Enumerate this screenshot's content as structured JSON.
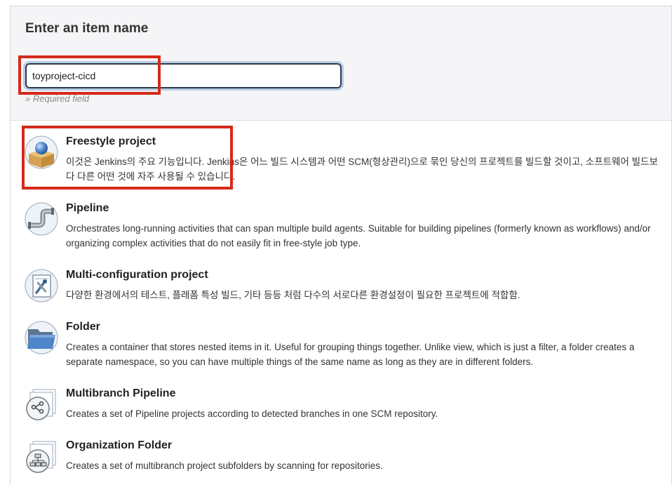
{
  "form": {
    "title": "Enter an item name",
    "name_value": "toyproject-cicd",
    "required_hint": "» Required field"
  },
  "items": [
    {
      "title": "Freestyle project",
      "description": "이것은 Jenkins의 주요 기능입니다. Jenkins은 어느 빌드 시스템과 어떤 SCM(형상관리)으로 묶인 당신의 프로젝트를 빌드할 것이고, 소프트웨어 빌드보다 다른 어떤 것에 자주 사용될 수 있습니다.",
      "icon": "freestyle-project-icon"
    },
    {
      "title": "Pipeline",
      "description": "Orchestrates long-running activities that can span multiple build agents. Suitable for building pipelines (formerly known as workflows) and/or organizing complex activities that do not easily fit in free-style job type.",
      "icon": "pipeline-icon"
    },
    {
      "title": "Multi-configuration project",
      "description": "다양한 환경에서의 테스트, 플래폼 특성 빌드, 기타 등등 처럼 다수의 서로다른 환경설정이 필요한 프로젝트에 적합함.",
      "icon": "multi-configuration-icon"
    },
    {
      "title": "Folder",
      "description": "Creates a container that stores nested items in it. Useful for grouping things together. Unlike view, which is just a filter, a folder creates a separate namespace, so you can have multiple things of the same name as long as they are in different folders.",
      "icon": "folder-icon"
    },
    {
      "title": "Multibranch Pipeline",
      "description": "Creates a set of Pipeline projects according to detected branches in one SCM repository.",
      "icon": "multibranch-pipeline-icon"
    },
    {
      "title": "Organization Folder",
      "description": "Creates a set of multibranch project subfolders by scanning for repositories.",
      "icon": "organization-folder-icon"
    }
  ],
  "colors": {
    "highlight": "#d42a1a",
    "header_bg": "#f5f5f7",
    "input_border": "#2b3a4a"
  }
}
